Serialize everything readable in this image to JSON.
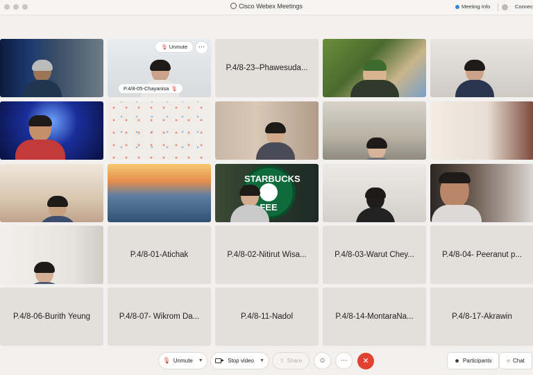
{
  "window": {
    "title": "Cisco Webex Meetings",
    "meeting_info_label": "Meeting Info",
    "connection_label": "Connec"
  },
  "tiles": [
    {
      "type": "video",
      "scene": "man-in-office"
    },
    {
      "type": "video",
      "scene": "girl-at-desk",
      "name": "P.4/8-05-Chayanisa",
      "unmute_label": "Unmute",
      "more_label": "⋯"
    },
    {
      "type": "name",
      "name": "P.4/8-23–Phawesuda..."
    },
    {
      "type": "video",
      "scene": "anime-character"
    },
    {
      "type": "video",
      "scene": "girl-with-earphones"
    },
    {
      "type": "video",
      "scene": "woman-space-background"
    },
    {
      "type": "video",
      "scene": "patterned-wallpaper"
    },
    {
      "type": "video",
      "scene": "girl-at-desk"
    },
    {
      "type": "video",
      "scene": "bedroom-shelves"
    },
    {
      "type": "video",
      "scene": "bedroom-ceiling"
    },
    {
      "type": "video",
      "scene": "boy-with-pictures"
    },
    {
      "type": "video",
      "scene": "ocean-sunset"
    },
    {
      "type": "video",
      "scene": "boy-starbucks-logo",
      "logo_top": "STARBUCKS",
      "logo_bottom": "FEE"
    },
    {
      "type": "video",
      "scene": "office-chair-room"
    },
    {
      "type": "video",
      "scene": "boy-close-up"
    },
    {
      "type": "video",
      "scene": "girl-in-chair"
    },
    {
      "type": "name",
      "name": "P.4/8-01-Atichak"
    },
    {
      "type": "name",
      "name": "P.4/8-02-Nitirut Wisa..."
    },
    {
      "type": "name",
      "name": "P.4/8-03-Warut Chey..."
    },
    {
      "type": "name",
      "name": "P.4/8-04- Peeranut p..."
    },
    {
      "type": "name",
      "name": "P.4/8-06-Burith Yeung"
    },
    {
      "type": "name",
      "name": "P.4/8-07- Wikrom Da..."
    },
    {
      "type": "name",
      "name": "P.4/8-11-Nadol"
    },
    {
      "type": "name",
      "name": "P.4/8-14-MontaraNa..."
    },
    {
      "type": "name",
      "name": "P.4/8-17-Akrawin"
    }
  ],
  "toolbar": {
    "unmute_label": "Unmute",
    "stop_video_label": "Stop video",
    "share_label": "Share",
    "reactions_icon": "emoji-icon",
    "more_label": "⋯",
    "end_icon": "close-icon",
    "participants_label": "Participants",
    "chat_label": "Chat"
  },
  "colors": {
    "end_button": "#e2412f",
    "muted_mic": "#d83a2a",
    "tile_background": "#e3dfdb"
  }
}
